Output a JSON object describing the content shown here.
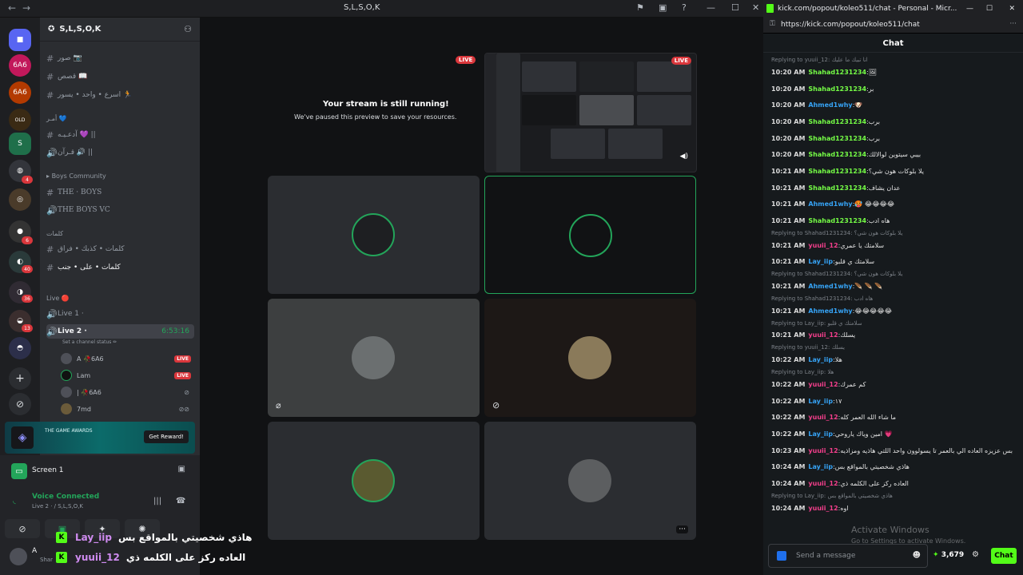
{
  "window": {
    "title": "S,L,S,O,K",
    "nav_back": "←",
    "nav_forward": "→",
    "ctrl_min": "—",
    "ctrl_max": "☐",
    "ctrl_close": "✕"
  },
  "rail": {
    "badges": [
      "4",
      "6",
      "40",
      "36",
      "13"
    ]
  },
  "server": {
    "name": "S,L,S,O,K",
    "channels": [
      {
        "label": "صور 📷"
      },
      {
        "label": "قصص 📖"
      },
      {
        "label": "اسرع • واحد • يسور 🏃"
      },
      {
        "label": "آدعـيـه 💜 ||"
      },
      {
        "label": "قـرآن 🔊 ||"
      }
    ],
    "cat_blue": "أمـر 💙",
    "cat_boys": "Boys Community",
    "boys_channels": [
      "THE · BOYS",
      "THE BOYS VC"
    ],
    "cat_words": "كلمات",
    "words_channels": [
      "كلمات • كذبك • فراق",
      "كلمات • على • جنب"
    ],
    "cat_live": "Live 🔴",
    "live1": "Live 1 ·",
    "live2": "Live 2 ·",
    "live2_time": "6:53:16",
    "set_status": "Set a channel status ✏",
    "voice_users": [
      {
        "name": "A 🥀6A6",
        "live": "LIVE"
      },
      {
        "name": "Lam",
        "live": "LIVE"
      },
      {
        "name": "| 🥀6A6",
        "live": ""
      },
      {
        "name": "7md",
        "live": ""
      }
    ]
  },
  "promo": {
    "brand": "THE GAME AWARDS",
    "button": "Get Reward!"
  },
  "screen": {
    "label": "Screen 1"
  },
  "voice": {
    "status": "Voice Connected",
    "location": "Live 2 · / S,L,S,O,K"
  },
  "account": {
    "initial": "A",
    "sub": "Shar"
  },
  "stage": {
    "paused_title": "Your stream is still running!",
    "paused_sub": "We've paused this preview to save your resources.",
    "live_badge": "LIVE",
    "more": "···"
  },
  "browser": {
    "title": "kick.com/popout/koleo511/chat - Personal - Micr...",
    "url": "https://kick.com/popout/koleo511/chat",
    "chat_title": "Chat"
  },
  "chat": [
    {
      "reply": "Replying to yuuii_12: انا تبيك ما عليك"
    },
    {
      "time": "10:20 AM",
      "user": "Shahad1231234",
      "color": "#75fd46",
      "text": "🖼"
    },
    {
      "time": "10:20 AM",
      "user": "Shahad1231234",
      "color": "#75fd46",
      "text": "بر"
    },
    {
      "time": "10:20 AM",
      "user": "Ahmed1why",
      "color": "#36a3f5",
      "text": "🐶"
    },
    {
      "time": "10:20 AM",
      "user": "Shahad1231234",
      "color": "#75fd46",
      "text": "برب"
    },
    {
      "time": "10:20 AM",
      "user": "Shahad1231234",
      "color": "#75fd46",
      "text": "برب"
    },
    {
      "time": "10:20 AM",
      "user": "Shahad1231234",
      "color": "#75fd46",
      "text": "بيبي سيتوين لوالالك"
    },
    {
      "time": "10:21 AM",
      "user": "Shahad1231234",
      "color": "#75fd46",
      "text": "يلا بلوكات هون شي؟"
    },
    {
      "time": "10:21 AM",
      "user": "Shahad1231234",
      "color": "#75fd46",
      "text": "عدان يشاف"
    },
    {
      "time": "10:21 AM",
      "user": "Ahmed1why",
      "color": "#36a3f5",
      "text": "🥵 😂😂😂😂"
    },
    {
      "time": "10:21 AM",
      "user": "Shahad1231234",
      "color": "#75fd46",
      "text": "هاه ادب"
    },
    {
      "reply": "Replying to Shahad1231234: يلا بلوكات هون شي؟"
    },
    {
      "time": "10:21 AM",
      "user": "yuuii_12",
      "color": "#f43f8c",
      "text": "سلامتك يا عمري"
    },
    {
      "time": "10:21 AM",
      "user": "Lay_iip",
      "color": "#36a3f5",
      "text": "سلامتك ي قلبو"
    },
    {
      "reply": "Replying to Shahad1231234: يلا بلوكات هون شي؟"
    },
    {
      "time": "10:21 AM",
      "user": "Ahmed1why",
      "color": "#36a3f5",
      "text": "🪶 🪶 🪶"
    },
    {
      "reply": "Replying to Shahad1231234: هاه ادب"
    },
    {
      "time": "10:21 AM",
      "user": "Ahmed1why",
      "color": "#36a3f5",
      "text": "😂😂😂😂😂"
    },
    {
      "reply": "Replying to Lay_iip: سلامتك ي قلبو"
    },
    {
      "time": "10:21 AM",
      "user": "yuuii_12",
      "color": "#f43f8c",
      "text": "يسلك"
    },
    {
      "reply": "Replying to yuuii_12: يسلك"
    },
    {
      "time": "10:22 AM",
      "user": "Lay_iip",
      "color": "#36a3f5",
      "text": "هلا"
    },
    {
      "reply": "Replying to Lay_iip: هلا"
    },
    {
      "time": "10:22 AM",
      "user": "yuuii_12",
      "color": "#f43f8c",
      "text": "كم عمرك"
    },
    {
      "time": "10:22 AM",
      "user": "Lay_iip",
      "color": "#36a3f5",
      "text": "١٧"
    },
    {
      "time": "10:22 AM",
      "user": "yuuii_12",
      "color": "#f43f8c",
      "text": "ما شاء الله العمر كله"
    },
    {
      "time": "10:22 AM",
      "user": "Lay_iip",
      "color": "#36a3f5",
      "text": "امين وياك ياروحي 💗"
    },
    {
      "time": "10:23 AM",
      "user": "yuuii_12",
      "color": "#f43f8c",
      "text": "بس عزيزه العاده الي بالعمر تا يسولوون واحد اللتي هاذيه ومزاذيه"
    },
    {
      "time": "10:24 AM",
      "user": "Lay_iip",
      "color": "#36a3f5",
      "text": "هاذي شخصيتي بالمواقع بس"
    },
    {
      "time": "10:24 AM",
      "user": "yuuii_12",
      "color": "#f43f8c",
      "text": "العاده ركز على الكلمه ذي"
    },
    {
      "reply": "Replying to Lay_iip: هاذي شخصيتي بالمواقع بس"
    },
    {
      "time": "10:24 AM",
      "user": "yuuii_12",
      "color": "#f43f8c",
      "text": "اوه"
    }
  ],
  "chat_input": {
    "placeholder": "Send a message",
    "points": "3,679",
    "send": "Chat"
  },
  "watermark": {
    "title": "Activate Windows",
    "sub": "Go to Settings to activate Windows."
  },
  "overlay": [
    {
      "user": "Lay_iip",
      "text": "هاذي شخصيتي بالمواقع بس"
    },
    {
      "user": "yuuii_12",
      "text": "العاده ركز على الكلمه ذي"
    }
  ]
}
